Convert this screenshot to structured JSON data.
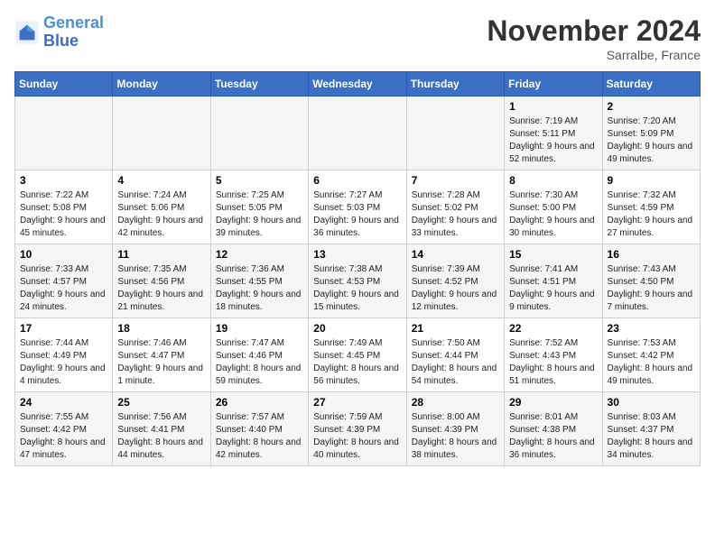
{
  "header": {
    "logo_line1": "General",
    "logo_line2": "Blue",
    "month_title": "November 2024",
    "location": "Sarralbe, France"
  },
  "days_of_week": [
    "Sunday",
    "Monday",
    "Tuesday",
    "Wednesday",
    "Thursday",
    "Friday",
    "Saturday"
  ],
  "weeks": [
    [
      {
        "day": "",
        "info": ""
      },
      {
        "day": "",
        "info": ""
      },
      {
        "day": "",
        "info": ""
      },
      {
        "day": "",
        "info": ""
      },
      {
        "day": "",
        "info": ""
      },
      {
        "day": "1",
        "info": "Sunrise: 7:19 AM\nSunset: 5:11 PM\nDaylight: 9 hours and 52 minutes."
      },
      {
        "day": "2",
        "info": "Sunrise: 7:20 AM\nSunset: 5:09 PM\nDaylight: 9 hours and 49 minutes."
      }
    ],
    [
      {
        "day": "3",
        "info": "Sunrise: 7:22 AM\nSunset: 5:08 PM\nDaylight: 9 hours and 45 minutes."
      },
      {
        "day": "4",
        "info": "Sunrise: 7:24 AM\nSunset: 5:06 PM\nDaylight: 9 hours and 42 minutes."
      },
      {
        "day": "5",
        "info": "Sunrise: 7:25 AM\nSunset: 5:05 PM\nDaylight: 9 hours and 39 minutes."
      },
      {
        "day": "6",
        "info": "Sunrise: 7:27 AM\nSunset: 5:03 PM\nDaylight: 9 hours and 36 minutes."
      },
      {
        "day": "7",
        "info": "Sunrise: 7:28 AM\nSunset: 5:02 PM\nDaylight: 9 hours and 33 minutes."
      },
      {
        "day": "8",
        "info": "Sunrise: 7:30 AM\nSunset: 5:00 PM\nDaylight: 9 hours and 30 minutes."
      },
      {
        "day": "9",
        "info": "Sunrise: 7:32 AM\nSunset: 4:59 PM\nDaylight: 9 hours and 27 minutes."
      }
    ],
    [
      {
        "day": "10",
        "info": "Sunrise: 7:33 AM\nSunset: 4:57 PM\nDaylight: 9 hours and 24 minutes."
      },
      {
        "day": "11",
        "info": "Sunrise: 7:35 AM\nSunset: 4:56 PM\nDaylight: 9 hours and 21 minutes."
      },
      {
        "day": "12",
        "info": "Sunrise: 7:36 AM\nSunset: 4:55 PM\nDaylight: 9 hours and 18 minutes."
      },
      {
        "day": "13",
        "info": "Sunrise: 7:38 AM\nSunset: 4:53 PM\nDaylight: 9 hours and 15 minutes."
      },
      {
        "day": "14",
        "info": "Sunrise: 7:39 AM\nSunset: 4:52 PM\nDaylight: 9 hours and 12 minutes."
      },
      {
        "day": "15",
        "info": "Sunrise: 7:41 AM\nSunset: 4:51 PM\nDaylight: 9 hours and 9 minutes."
      },
      {
        "day": "16",
        "info": "Sunrise: 7:43 AM\nSunset: 4:50 PM\nDaylight: 9 hours and 7 minutes."
      }
    ],
    [
      {
        "day": "17",
        "info": "Sunrise: 7:44 AM\nSunset: 4:49 PM\nDaylight: 9 hours and 4 minutes."
      },
      {
        "day": "18",
        "info": "Sunrise: 7:46 AM\nSunset: 4:47 PM\nDaylight: 9 hours and 1 minute."
      },
      {
        "day": "19",
        "info": "Sunrise: 7:47 AM\nSunset: 4:46 PM\nDaylight: 8 hours and 59 minutes."
      },
      {
        "day": "20",
        "info": "Sunrise: 7:49 AM\nSunset: 4:45 PM\nDaylight: 8 hours and 56 minutes."
      },
      {
        "day": "21",
        "info": "Sunrise: 7:50 AM\nSunset: 4:44 PM\nDaylight: 8 hours and 54 minutes."
      },
      {
        "day": "22",
        "info": "Sunrise: 7:52 AM\nSunset: 4:43 PM\nDaylight: 8 hours and 51 minutes."
      },
      {
        "day": "23",
        "info": "Sunrise: 7:53 AM\nSunset: 4:42 PM\nDaylight: 8 hours and 49 minutes."
      }
    ],
    [
      {
        "day": "24",
        "info": "Sunrise: 7:55 AM\nSunset: 4:42 PM\nDaylight: 8 hours and 47 minutes."
      },
      {
        "day": "25",
        "info": "Sunrise: 7:56 AM\nSunset: 4:41 PM\nDaylight: 8 hours and 44 minutes."
      },
      {
        "day": "26",
        "info": "Sunrise: 7:57 AM\nSunset: 4:40 PM\nDaylight: 8 hours and 42 minutes."
      },
      {
        "day": "27",
        "info": "Sunrise: 7:59 AM\nSunset: 4:39 PM\nDaylight: 8 hours and 40 minutes."
      },
      {
        "day": "28",
        "info": "Sunrise: 8:00 AM\nSunset: 4:39 PM\nDaylight: 8 hours and 38 minutes."
      },
      {
        "day": "29",
        "info": "Sunrise: 8:01 AM\nSunset: 4:38 PM\nDaylight: 8 hours and 36 minutes."
      },
      {
        "day": "30",
        "info": "Sunrise: 8:03 AM\nSunset: 4:37 PM\nDaylight: 8 hours and 34 minutes."
      }
    ]
  ]
}
